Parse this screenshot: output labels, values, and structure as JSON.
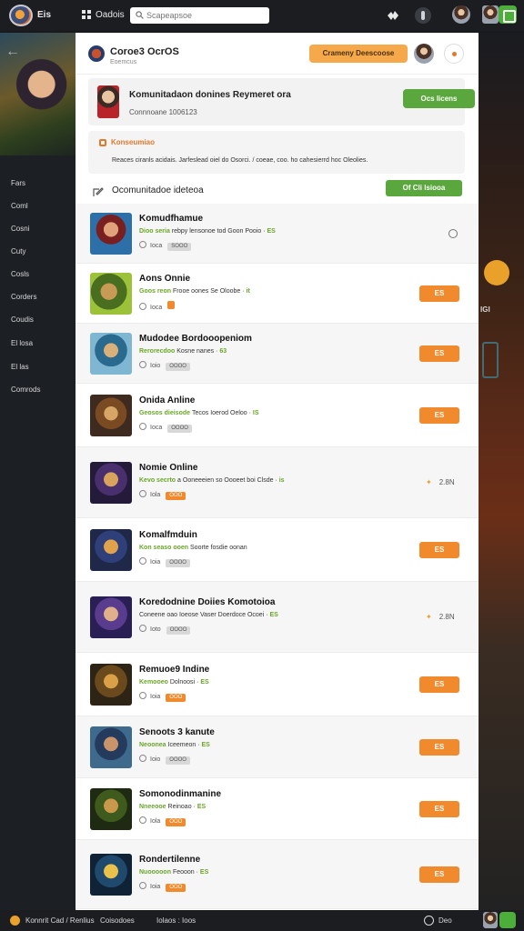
{
  "topbar": {
    "brand": "Eis",
    "categories_label": "Oadois",
    "search_placeholder": "Scapeapsoe"
  },
  "sidebar": {
    "items": [
      "Fars",
      "Coml",
      "Cosni",
      "Cuty",
      "Cosls",
      "Corders",
      "Coudis",
      "El losa",
      "El las",
      "Comrods"
    ]
  },
  "right_decor": {
    "tag": "IGI"
  },
  "header": {
    "title": "Coroe3 OcrOS",
    "subtitle": "Eoemcus",
    "action_label": "Crameny Deescoose"
  },
  "profile": {
    "name": "Komunitadaon donines Reymeret ora",
    "meta": "Connnoane 1006123",
    "follow_label": "Ocs licens"
  },
  "notice": {
    "title": "Konseumiao",
    "text": "Reaces ciranls acidais. Jarfeslead oiel do Osorci. / coeae, coo. ho cahesierrd hoc Oleolies."
  },
  "community": {
    "label": "Ocomunitadoe ideteoa",
    "join_label": "Of Cli lsiooa"
  },
  "games": [
    {
      "title": "Komudfhamue",
      "sub_hl": "Dioo seria",
      "sub": "rebpy lensonoe tod Goon Pooio",
      "sub_tail": "ES",
      "time": "Ioca",
      "pill": "SOOO",
      "pill_color": "grey",
      "action": "circle"
    },
    {
      "title": "Aons Onnie",
      "sub_hl": "Goos reon",
      "sub": "Frooe oones Se Oloobe",
      "sub_tail": "it",
      "time": "Ioca",
      "pill": "",
      "pill_color": "orange",
      "action": "button",
      "button": "ES"
    },
    {
      "title": "Mudodee Bordooopeniom",
      "sub_hl": "Rerorecdoo",
      "sub": "Kosne nanes",
      "sub_tail": "63",
      "time": "Ioio",
      "pill": "OOOO",
      "pill_color": "grey",
      "action": "button",
      "button": "ES"
    },
    {
      "title": "Onida Anline",
      "sub_hl": "Geosos dieisode",
      "sub": "Tecos Ioerod Oeloo",
      "sub_tail": "IS",
      "time": "Ioca",
      "pill": "OOOO",
      "pill_color": "grey",
      "action": "button",
      "button": "ES"
    },
    {
      "title": "Nomie Online",
      "sub_hl": "Kevo secrto",
      "sub": "a Ooneeeien so Oooeet boi Clsde",
      "sub_tail": "is",
      "time": "Iola",
      "pill": "OOO",
      "pill_color": "orange",
      "action": "stat",
      "stat": "2.8N"
    },
    {
      "title": "Komalfmduin",
      "sub_hl": "Kon seaso ooen",
      "sub": "Soorte fosdie oonan",
      "sub_tail": "",
      "time": "Ioia",
      "pill": "OOOO",
      "pill_color": "grey",
      "action": "button",
      "button": "ES"
    },
    {
      "title": "Koredodnine Doiies Komotoioa",
      "sub_hl": "",
      "sub": "Coneene oao Ioeose Vaser Doerdoce Ocoei",
      "sub_tail": "ES",
      "time": "Ioto",
      "pill": "OOOO",
      "pill_color": "grey",
      "action": "stat",
      "stat": "2.8N"
    },
    {
      "title": "Remuoe9 Indine",
      "sub_hl": "Kemooeo",
      "sub": "Dolnoosi",
      "sub_tail": "ES",
      "time": "Ioia",
      "pill": "OOO",
      "pill_color": "orange",
      "action": "button",
      "button": "ES"
    },
    {
      "title": "Senoots 3 kanute",
      "sub_hl": "Neoonea",
      "sub": "Iceemeon",
      "sub_tail": "ES",
      "time": "Ioio",
      "pill": "OOOO",
      "pill_color": "grey",
      "action": "button",
      "button": "ES"
    },
    {
      "title": "Somonodinmanine",
      "sub_hl": "Nneeooe",
      "sub": "Reinoao",
      "sub_tail": "ES",
      "time": "Iola",
      "pill": "OOO",
      "pill_color": "orange",
      "action": "button",
      "button": "ES"
    },
    {
      "title": "Rondertilenne",
      "sub_hl": "Nuooooon",
      "sub": "Feooon",
      "sub_tail": "ES",
      "time": "Ioia",
      "pill": "OOO",
      "pill_color": "orange",
      "action": "button",
      "button": "ES"
    }
  ],
  "bottombar": {
    "left": "Konnrit Cad / Renlius",
    "mid1": "Coisodoes",
    "mid2": "Iolaos : Ioos",
    "right": "Deo"
  },
  "colors": {
    "accent_orange": "#f08a2c",
    "accent_green": "#5aa73e",
    "highlight_green": "#6aa629"
  }
}
